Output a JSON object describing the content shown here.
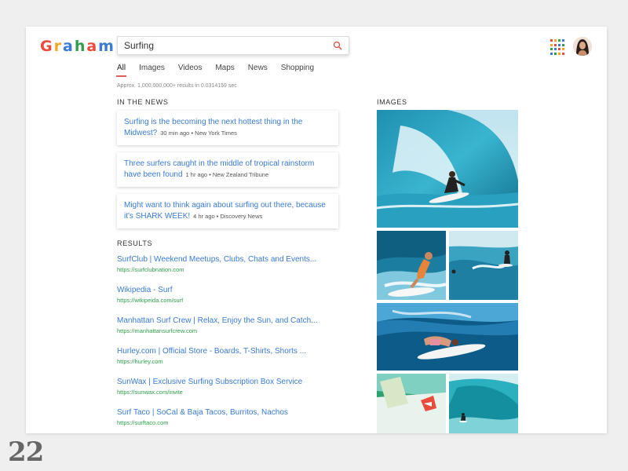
{
  "logo": {
    "letters": [
      {
        "char": "G",
        "color": "#e94b3c"
      },
      {
        "char": "r",
        "color": "#f4a62a"
      },
      {
        "char": "a",
        "color": "#3a7bd5"
      },
      {
        "char": "h",
        "color": "#2e9e4a"
      },
      {
        "char": "a",
        "color": "#e94b3c"
      },
      {
        "char": "m",
        "color": "#3a7bd5"
      }
    ]
  },
  "search": {
    "query": "Surfing",
    "icon": "search-icon",
    "icon_color": "#e94b3c"
  },
  "header": {
    "apps_icon": "apps-grid-icon",
    "avatar": "user-avatar"
  },
  "tabs": [
    {
      "label": "All",
      "active": true
    },
    {
      "label": "Images",
      "active": false
    },
    {
      "label": "Videos",
      "active": false
    },
    {
      "label": "Maps",
      "active": false
    },
    {
      "label": "News",
      "active": false
    },
    {
      "label": "Shopping",
      "active": false
    }
  ],
  "result_count": "Approx. 1,000,000,000+ results in 0.0314159 sec",
  "news": {
    "heading": "IN THE NEWS",
    "items": [
      {
        "title": "Surfing is the becoming the next hottest thing in the Midwest?",
        "meta": "30 min ago • New York Times"
      },
      {
        "title": "Three surfers caught in the middle of tropical rainstorm have been found",
        "meta": "1 hr ago • New Zealand Tribune"
      },
      {
        "title": "Might want to think again about surfing out there, because it's SHARK WEEK!",
        "meta": "4 hr ago • Discovery News"
      }
    ]
  },
  "results": {
    "heading": "RESULTS",
    "items": [
      {
        "title": "SurfClub | Weekend Meetups, Clubs, Chats and Events...",
        "url": "https://surfclubnation.com"
      },
      {
        "title": "Wikipedia - Surf",
        "url": "https://wikipeida.com/surf"
      },
      {
        "title": "Manhattan Surf Crew | Relax, Enjoy the Sun, and Catch...",
        "url": "https://manhattansurfcrew.com"
      },
      {
        "title": "Hurley.com | Official Store -  Boards, T-Shirts, Shorts ...",
        "url": "https://hurley.com"
      },
      {
        "title": "SunWax | Exclusive Surfing Subscription Box Service",
        "url": "https://sunwax.com/invite"
      },
      {
        "title": "Surf Taco | SoCal & Baja Tacos, Burritos, Nachos",
        "url": "https://surftaco.com"
      }
    ]
  },
  "images": {
    "heading": "IMAGES"
  },
  "shot_number": "22",
  "colors": {
    "link": "#3a7bd5",
    "url": "#2e9e4a",
    "accent": "#e0615b"
  }
}
